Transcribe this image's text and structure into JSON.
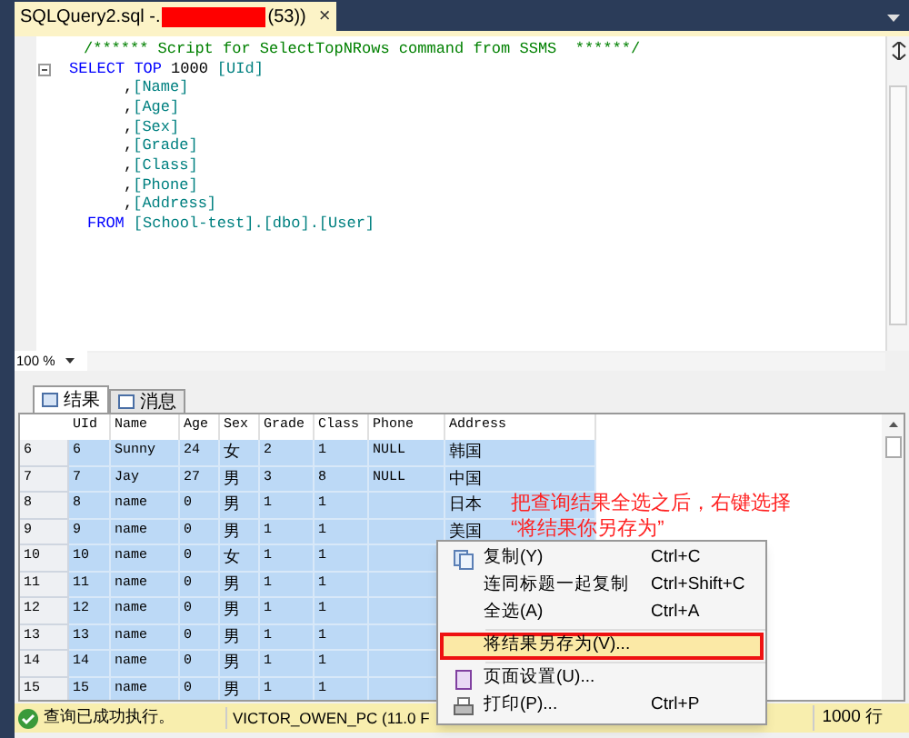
{
  "editor_tab": {
    "title_start": "SQLQuery2.sql -.",
    "title_end": "(53))",
    "close": "×"
  },
  "editor": {
    "lines": [
      {
        "kind": "comment",
        "segments": [
          {
            "kind": "comment",
            "text": "/****** Script for SelectTopNRows command from SSMS  ******/"
          }
        ]
      },
      {
        "kind": "start",
        "segments": [
          {
            "kind": "keyword",
            "text": "SELECT TOP"
          },
          {
            "kind": "plain",
            "text": "1000"
          },
          {
            "kind": "ident",
            "text": "[UId]"
          }
        ]
      },
      {
        "kind": "column",
        "segments": [
          {
            "kind": "plain",
            "text": ","
          },
          {
            "kind": "ident",
            "text": "[Name]"
          }
        ]
      },
      {
        "kind": "column",
        "segments": [
          {
            "kind": "plain",
            "text": ","
          },
          {
            "kind": "ident",
            "text": "[Age]"
          }
        ]
      },
      {
        "kind": "column",
        "segments": [
          {
            "kind": "plain",
            "text": ","
          },
          {
            "kind": "ident",
            "text": "[Sex]"
          }
        ]
      },
      {
        "kind": "column",
        "segments": [
          {
            "kind": "plain",
            "text": ","
          },
          {
            "kind": "ident",
            "text": "[Grade]"
          }
        ]
      },
      {
        "kind": "column",
        "segments": [
          {
            "kind": "plain",
            "text": ","
          },
          {
            "kind": "ident",
            "text": "[Class]"
          }
        ]
      },
      {
        "kind": "column",
        "segments": [
          {
            "kind": "plain",
            "text": ","
          },
          {
            "kind": "ident",
            "text": "[Phone]"
          }
        ]
      },
      {
        "kind": "column",
        "segments": [
          {
            "kind": "plain",
            "text": ","
          },
          {
            "kind": "ident",
            "text": "[Address]"
          }
        ]
      },
      {
        "kind": "from",
        "segments": [
          {
            "kind": "keyword",
            "text": "FROM"
          },
          {
            "kind": "ident",
            "text": "[School-test].[dbo].[User]"
          }
        ]
      }
    ]
  },
  "zoom": {
    "value": "100 %"
  },
  "result_tabs": [
    {
      "label": "结果",
      "selected": true
    },
    {
      "label": "消息",
      "selected": false
    }
  ],
  "grid": {
    "columns": [
      "UId",
      "Name",
      "Age",
      "Sex",
      "Grade",
      "Class",
      "Phone",
      "Address"
    ],
    "rows": [
      {
        "header": "6",
        "selected": true,
        "cells": [
          "6",
          "Sunny",
          "24",
          "女",
          "2",
          "1",
          "NULL",
          "韩国"
        ]
      },
      {
        "header": "7",
        "selected": true,
        "cells": [
          "7",
          "Jay",
          "27",
          "男",
          "3",
          "8",
          "NULL",
          "中国"
        ]
      },
      {
        "header": "8",
        "selected": true,
        "cells": [
          "8",
          "name",
          "0",
          "男",
          "1",
          "1",
          "",
          "日本"
        ]
      },
      {
        "header": "9",
        "selected": true,
        "cells": [
          "9",
          "name",
          "0",
          "男",
          "1",
          "1",
          "",
          "美国"
        ]
      },
      {
        "header": "10",
        "selected": true,
        "cells": [
          "10",
          "name",
          "0",
          "女",
          "1",
          "1",
          ""
        ]
      },
      {
        "header": "11",
        "selected": true,
        "cells": [
          "11",
          "name",
          "0",
          "男",
          "1",
          "1",
          ""
        ]
      },
      {
        "header": "12",
        "selected": true,
        "cells": [
          "12",
          "name",
          "0",
          "男",
          "1",
          "1",
          ""
        ]
      },
      {
        "header": "13",
        "selected": true,
        "cells": [
          "13",
          "name",
          "0",
          "男",
          "1",
          "1",
          ""
        ]
      },
      {
        "header": "14",
        "selected": true,
        "cells": [
          "14",
          "name",
          "0",
          "男",
          "1",
          "1",
          ""
        ]
      },
      {
        "header": "15",
        "selected": true,
        "cells": [
          "15",
          "name",
          "0",
          "男",
          "1",
          "1",
          ""
        ]
      }
    ]
  },
  "annotation": {
    "lines": [
      "把查询结果全选之后，右键选择",
      "“将结果你另存为”"
    ]
  },
  "context_menu": {
    "items": [
      {
        "kind": "copy",
        "label": "复制(Y)",
        "shortcut": "Ctrl+C",
        "selected": false
      },
      {
        "kind": "plain",
        "label": "连同标题一起复制",
        "shortcut": "Ctrl+Shift+C",
        "selected": false
      },
      {
        "kind": "plain",
        "label": "全选(A)",
        "shortcut": "Ctrl+A",
        "selected": false
      },
      {
        "kind": "separator"
      },
      {
        "kind": "plain",
        "label": "将结果另存为(V)...",
        "selected": true
      },
      {
        "kind": "separator"
      },
      {
        "kind": "page",
        "label": "页面设置(U)...",
        "selected": false
      },
      {
        "kind": "print",
        "label": "打印(P)...",
        "shortcut": "Ctrl+P",
        "selected": false
      }
    ]
  },
  "status_bar": {
    "message": "查询已成功执行。",
    "server": "VICTOR_OWEN_PC (11.0 F",
    "rows": "1000 行"
  }
}
